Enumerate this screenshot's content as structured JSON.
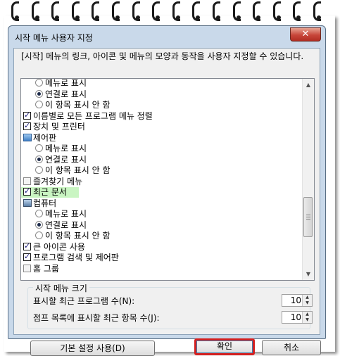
{
  "window": {
    "title": "시작 메뉴 사용자 지정",
    "close_label": "✕"
  },
  "description": "[시작] 메뉴의 링크, 아이콘 및 메뉴의 모양과 동작을 사용자 지정할 수 있습니다.",
  "list_items": [
    {
      "label": "메뉴로 표시",
      "kind": "radio",
      "checked": false,
      "indent": 1
    },
    {
      "label": "연결로 표시",
      "kind": "radio",
      "checked": true,
      "indent": 1
    },
    {
      "label": "이 항목 표시 안 함",
      "kind": "radio",
      "checked": false,
      "indent": 1
    },
    {
      "label": "이름별로 모든 프로그램 메뉴 정렬",
      "kind": "checkbox",
      "checked": true,
      "indent": 0
    },
    {
      "label": "장치 및 프린터",
      "kind": "checkbox",
      "checked": true,
      "indent": 0
    },
    {
      "label": "제어판",
      "kind": "header",
      "icon": "control-panel-icon",
      "indent": 0
    },
    {
      "label": "메뉴로 표시",
      "kind": "radio",
      "checked": false,
      "indent": 1
    },
    {
      "label": "연결로 표시",
      "kind": "radio",
      "checked": true,
      "indent": 1
    },
    {
      "label": "이 항목 표시 안 함",
      "kind": "radio",
      "checked": false,
      "indent": 1
    },
    {
      "label": "즐겨찾기 메뉴",
      "kind": "checkbox",
      "checked": false,
      "indent": 0
    },
    {
      "label": "최근 문서",
      "kind": "checkbox",
      "checked": true,
      "indent": 0,
      "highlight": true
    },
    {
      "label": "컴퓨터",
      "kind": "header",
      "icon": "computer-icon",
      "indent": 0
    },
    {
      "label": "메뉴로 표시",
      "kind": "radio",
      "checked": false,
      "indent": 1
    },
    {
      "label": "연결로 표시",
      "kind": "radio",
      "checked": true,
      "indent": 1
    },
    {
      "label": "이 항목 표시 안 함",
      "kind": "radio",
      "checked": false,
      "indent": 1
    },
    {
      "label": "큰 아이콘 사용",
      "kind": "checkbox",
      "checked": true,
      "indent": 0
    },
    {
      "label": "프로그램 검색 및 제어판",
      "kind": "checkbox",
      "checked": true,
      "indent": 0
    },
    {
      "label": "홈 그룹",
      "kind": "checkbox",
      "checked": false,
      "indent": 0
    }
  ],
  "menu_size": {
    "title": "시작 메뉴 크기",
    "recent_programs_label": "표시할 최근 프로그램 수(N):",
    "recent_programs_value": "10",
    "jump_list_label": "점프 목록에 표시할 최근 항목 수(J):",
    "jump_list_value": "10"
  },
  "buttons": {
    "defaults": "기본 설정 사용(D)",
    "ok": "확인",
    "cancel": "취소"
  },
  "colors": {
    "highlight": "#c9f5c2",
    "ok_outline": "#d42020",
    "close_button": "#c7463a"
  }
}
